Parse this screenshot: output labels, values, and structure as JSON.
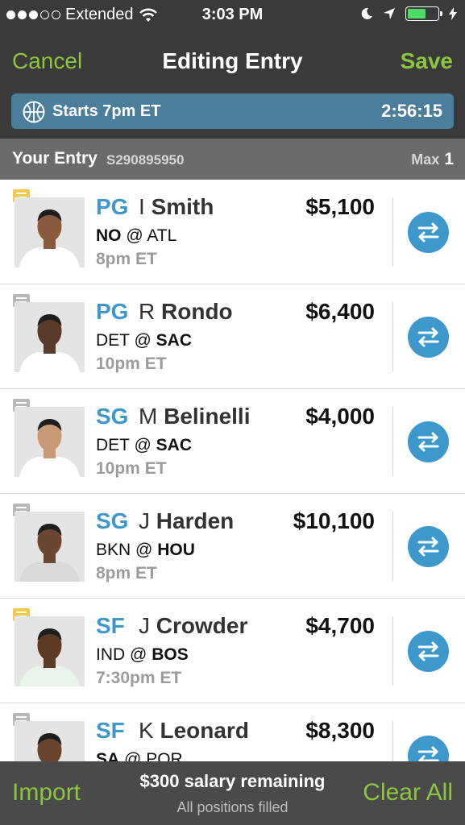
{
  "status_bar": {
    "carrier": "Extended",
    "time": "3:03 PM",
    "signal_filled": 3,
    "signal_total": 5,
    "battery_level": 0.6,
    "battery_color": "#4cd964"
  },
  "nav": {
    "cancel": "Cancel",
    "title": "Editing Entry",
    "save": "Save"
  },
  "contest": {
    "icon": "basketball-icon",
    "starts": "Starts 7pm ET",
    "timer": "2:56:15"
  },
  "entry": {
    "label": "Your Entry",
    "id": "S290895950",
    "max_label": "Max",
    "max_value": "1"
  },
  "players": [
    {
      "pos": "PG",
      "initial": "I",
      "last": "Smith",
      "salary": "$5,100",
      "away": "NO",
      "at": "@",
      "home": "ATL",
      "bold_team": "away",
      "time": "8pm ET",
      "note": "yellow"
    },
    {
      "pos": "PG",
      "initial": "R",
      "last": "Rondo",
      "salary": "$6,400",
      "away": "DET",
      "at": "@",
      "home": "SAC",
      "bold_team": "home",
      "time": "10pm ET",
      "note": "gray"
    },
    {
      "pos": "SG",
      "initial": "M",
      "last": "Belinelli",
      "salary": "$4,000",
      "away": "DET",
      "at": "@",
      "home": "SAC",
      "bold_team": "home",
      "time": "10pm ET",
      "note": "gray"
    },
    {
      "pos": "SG",
      "initial": "J",
      "last": "Harden",
      "salary": "$10,100",
      "away": "BKN",
      "at": "@",
      "home": "HOU",
      "bold_team": "home",
      "time": "8pm ET",
      "note": "gray"
    },
    {
      "pos": "SF",
      "initial": "J",
      "last": "Crowder",
      "salary": "$4,700",
      "away": "IND",
      "at": "@",
      "home": "BOS",
      "bold_team": "home",
      "time": "7:30pm ET",
      "note": "yellow"
    },
    {
      "pos": "SF",
      "initial": "K",
      "last": "Leonard",
      "salary": "$8,300",
      "away": "SA",
      "at": "@",
      "home": "POR",
      "bold_team": "away",
      "time": "",
      "note": "gray"
    }
  ],
  "footer": {
    "import": "Import",
    "salary_remaining": "$300 salary remaining",
    "status": "All positions filled",
    "clear": "Clear All"
  },
  "colors": {
    "accent_green": "#8cc63f",
    "position_blue": "#3d98cc",
    "contest_bar": "#4a7e9b",
    "note_yellow": "#f2c94c",
    "note_gray": "#b8b8b8"
  }
}
